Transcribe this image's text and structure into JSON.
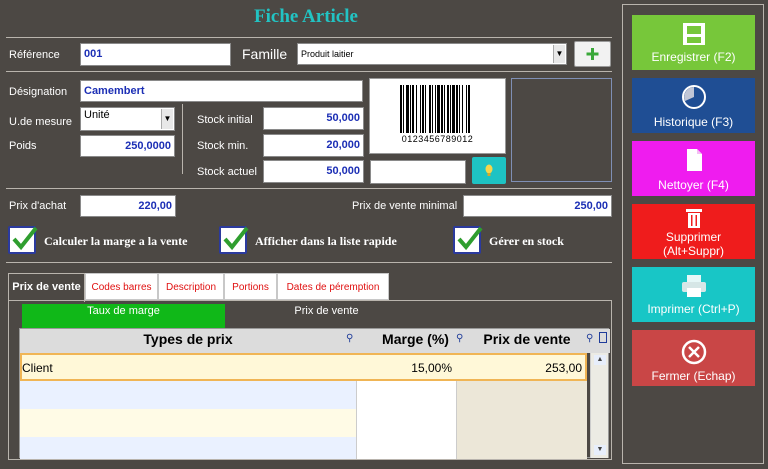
{
  "title": "Fiche Article",
  "labels": {
    "reference": "Référence",
    "famille": "Famille",
    "designation": "Désignation",
    "unite": "U.de mesure",
    "poids": "Poids",
    "stock_initial": "Stock initial",
    "stock_min": "Stock min.",
    "stock_actuel": "Stock actuel",
    "prix_achat": "Prix d'achat",
    "prix_vente_min": "Prix de vente minimal"
  },
  "fields": {
    "reference": "001",
    "famille": "Produit laitier",
    "designation": "Camembert",
    "unite": "Unité",
    "poids": "250,0000",
    "stock_initial": "50,000",
    "stock_min": "20,000",
    "stock_actuel": "50,000",
    "prix_achat": "220,00",
    "prix_vente_min": "250,00",
    "barcode_text": "0123456789012"
  },
  "checkboxes": [
    {
      "label": "Calculer la marge a la vente",
      "checked": true
    },
    {
      "label": "Afficher dans la liste rapide",
      "checked": true
    },
    {
      "label": "Gérer en stock",
      "checked": true
    }
  ],
  "tabs": [
    "Prix de vente",
    "Codes barres",
    "Description",
    "Portions",
    "Dates de péremption"
  ],
  "subtabs": [
    "Taux de marge",
    "Prix de vente"
  ],
  "grid": {
    "headers": [
      "Types de prix",
      "Marge (%)",
      "Prix de vente"
    ],
    "rows": [
      {
        "type": "Client",
        "marge": "15,00%",
        "prix": "253,00"
      }
    ]
  },
  "buttons": [
    {
      "label": "Enregistrer (F2)",
      "color": "#77c73a"
    },
    {
      "label": "Historique (F3)",
      "color": "#1f4e94"
    },
    {
      "label": "Nettoyer (F4)",
      "color": "#ef1cef"
    },
    {
      "label": "Supprimer (Alt+Suppr)",
      "color": "#ef1c1c"
    },
    {
      "label": "Imprimer (Ctrl+P)",
      "color": "#18c6c6"
    },
    {
      "label": "Fermer (Echap)",
      "color": "#c94646"
    }
  ],
  "colors": {
    "background": "#4c4844",
    "title": "#22c3c3",
    "value_text": "#1c2fb5",
    "tab_text": "#e01010",
    "subtab_active": "#10b818"
  }
}
